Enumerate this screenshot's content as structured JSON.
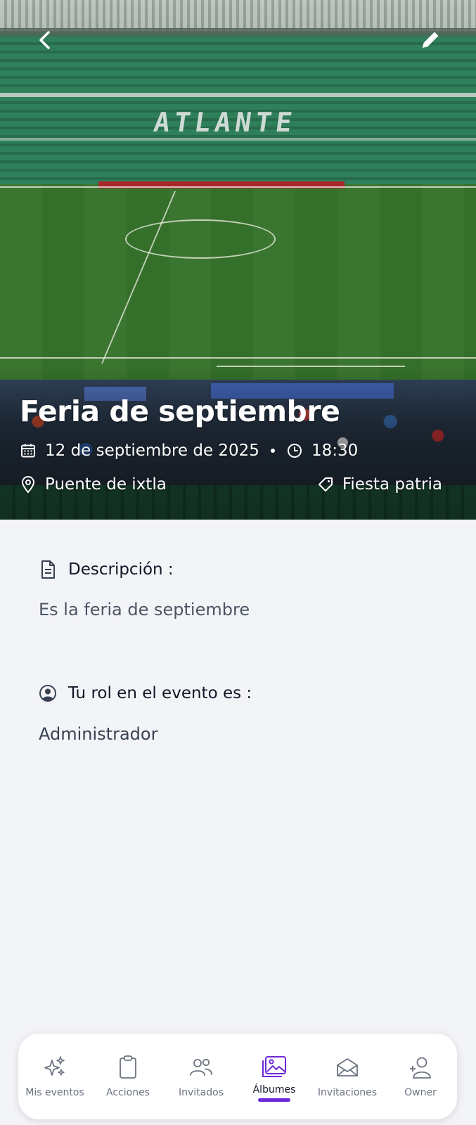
{
  "header": {
    "back_icon": "chevron-left-icon",
    "edit_icon": "pencil-icon",
    "cover_scene": "ATLANTE"
  },
  "event": {
    "title": "Feria de septiembre",
    "date": "12 de septiembre de 2025",
    "time": "18:30",
    "place": "Puente de ixtla",
    "category": "Fiesta patria"
  },
  "description": {
    "label": "Descripción :",
    "text": "Es la feria de septiembre"
  },
  "role": {
    "label": "Tu rol en el evento es :",
    "value": "Administrador"
  },
  "nav": {
    "items": [
      {
        "label": "Mis eventos",
        "icon": "sparkles-icon"
      },
      {
        "label": "Acciones",
        "icon": "clipboard-icon"
      },
      {
        "label": "Invitados",
        "icon": "users-icon"
      },
      {
        "label": "Álbumes",
        "icon": "images-icon"
      },
      {
        "label": "Invitaciones",
        "icon": "envelope-open-icon"
      },
      {
        "label": "Owner",
        "icon": "user-plus-icon"
      }
    ],
    "active": "Álbumes"
  },
  "colors": {
    "accent": "#6d28d9",
    "background": "#f3f4f8"
  }
}
